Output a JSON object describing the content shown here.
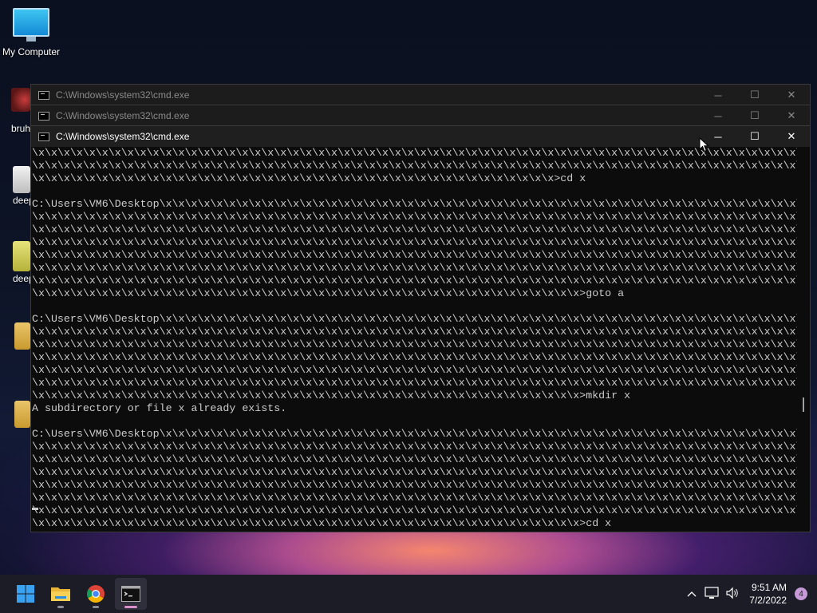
{
  "desktop": {
    "icons": [
      {
        "label": "My Computer"
      },
      {
        "label": "bruh"
      },
      {
        "label": "deep"
      },
      {
        "label": "deep"
      }
    ]
  },
  "windows": [
    {
      "title": "C:\\Windows\\system32\\cmd.exe",
      "state": "inactive"
    },
    {
      "title": "C:\\Windows\\system32\\cmd.exe",
      "state": "inactive"
    },
    {
      "title": "C:\\Windows\\system32\\cmd.exe",
      "state": "active"
    }
  ],
  "window_controls": {
    "minimize": "─",
    "maximize": "☐",
    "close": "✕"
  },
  "console": {
    "lines": [
      "\\x\\x\\x\\x\\x\\x\\x\\x\\x\\x\\x\\x\\x\\x\\x\\x\\x\\x\\x\\x\\x\\x\\x\\x\\x\\x\\x\\x\\x\\x\\x\\x\\x\\x\\x\\x\\x\\x\\x\\x\\x\\x\\x\\x\\x\\x\\x\\x\\x\\x\\x\\x\\x\\x\\x\\x\\x\\x\\x\\x\\x\\x\\x",
      "\\x\\x\\x\\x\\x\\x\\x\\x\\x\\x\\x\\x\\x\\x\\x\\x\\x\\x\\x\\x\\x\\x\\x\\x\\x\\x\\x\\x\\x\\x\\x\\x\\x\\x\\x\\x\\x\\x\\x\\x\\x\\x\\x\\x\\x\\x\\x\\x\\x\\x\\x\\x\\x\\x\\x\\x\\x\\x\\x\\x\\x\\x\\x",
      "\\x\\x\\x\\x\\x\\x\\x\\x\\x\\x\\x\\x\\x\\x\\x\\x\\x\\x\\x\\x\\x\\x\\x\\x\\x\\x\\x\\x\\x\\x\\x\\x\\x\\x\\x\\x\\x\\x\\x\\x\\x>cd x",
      "",
      "C:\\Users\\VM6\\Desktop\\x\\x\\x\\x\\x\\x\\x\\x\\x\\x\\x\\x\\x\\x\\x\\x\\x\\x\\x\\x\\x\\x\\x\\x\\x\\x\\x\\x\\x\\x\\x\\x\\x\\x\\x\\x\\x\\x\\x\\x\\x\\x\\x\\x\\x\\x\\x\\x\\x\\x\\x\\x\\x",
      "\\x\\x\\x\\x\\x\\x\\x\\x\\x\\x\\x\\x\\x\\x\\x\\x\\x\\x\\x\\x\\x\\x\\x\\x\\x\\x\\x\\x\\x\\x\\x\\x\\x\\x\\x\\x\\x\\x\\x\\x\\x\\x\\x\\x\\x\\x\\x\\x\\x\\x\\x\\x\\x\\x\\x\\x\\x\\x\\x\\x\\x\\x\\x",
      "\\x\\x\\x\\x\\x\\x\\x\\x\\x\\x\\x\\x\\x\\x\\x\\x\\x\\x\\x\\x\\x\\x\\x\\x\\x\\x\\x\\x\\x\\x\\x\\x\\x\\x\\x\\x\\x\\x\\x\\x\\x\\x\\x\\x\\x\\x\\x\\x\\x\\x\\x\\x\\x\\x\\x\\x\\x\\x\\x\\x\\x\\x\\x",
      "\\x\\x\\x\\x\\x\\x\\x\\x\\x\\x\\x\\x\\x\\x\\x\\x\\x\\x\\x\\x\\x\\x\\x\\x\\x\\x\\x\\x\\x\\x\\x\\x\\x\\x\\x\\x\\x\\x\\x\\x\\x\\x\\x\\x\\x\\x\\x\\x\\x\\x\\x\\x\\x\\x\\x\\x\\x\\x\\x\\x\\x\\x\\x",
      "\\x\\x\\x\\x\\x\\x\\x\\x\\x\\x\\x\\x\\x\\x\\x\\x\\x\\x\\x\\x\\x\\x\\x\\x\\x\\x\\x\\x\\x\\x\\x\\x\\x\\x\\x\\x\\x\\x\\x\\x\\x\\x\\x\\x\\x\\x\\x\\x\\x\\x\\x\\x\\x\\x\\x\\x\\x\\x\\x\\x\\x\\x\\x",
      "\\x\\x\\x\\x\\x\\x\\x\\x\\x\\x\\x\\x\\x\\x\\x\\x\\x\\x\\x\\x\\x\\x\\x\\x\\x\\x\\x\\x\\x\\x\\x\\x\\x\\x\\x\\x\\x\\x\\x\\x\\x\\x\\x\\x\\x\\x\\x\\x\\x\\x\\x\\x\\x\\x\\x\\x\\x\\x\\x\\x\\x\\x\\x",
      "\\x\\x\\x\\x\\x\\x\\x\\x\\x\\x\\x\\x\\x\\x\\x\\x\\x\\x\\x\\x\\x\\x\\x\\x\\x\\x\\x\\x\\x\\x\\x\\x\\x\\x\\x\\x\\x\\x\\x\\x\\x\\x\\x\\x\\x\\x\\x\\x\\x\\x\\x\\x\\x\\x\\x\\x\\x\\x\\x\\x\\x\\x\\x",
      "\\x\\x\\x\\x\\x\\x\\x\\x\\x\\x\\x\\x\\x\\x\\x\\x\\x\\x\\x\\x\\x\\x\\x\\x\\x\\x\\x\\x\\x\\x\\x\\x\\x\\x\\x\\x\\x\\x\\x\\x\\x\\x\\x>goto a",
      "",
      "C:\\Users\\VM6\\Desktop\\x\\x\\x\\x\\x\\x\\x\\x\\x\\x\\x\\x\\x\\x\\x\\x\\x\\x\\x\\x\\x\\x\\x\\x\\x\\x\\x\\x\\x\\x\\x\\x\\x\\x\\x\\x\\x\\x\\x\\x\\x\\x\\x\\x\\x\\x\\x\\x\\x\\x\\x\\x\\x",
      "\\x\\x\\x\\x\\x\\x\\x\\x\\x\\x\\x\\x\\x\\x\\x\\x\\x\\x\\x\\x\\x\\x\\x\\x\\x\\x\\x\\x\\x\\x\\x\\x\\x\\x\\x\\x\\x\\x\\x\\x\\x\\x\\x\\x\\x\\x\\x\\x\\x\\x\\x\\x\\x\\x\\x\\x\\x\\x\\x\\x\\x\\x\\x",
      "\\x\\x\\x\\x\\x\\x\\x\\x\\x\\x\\x\\x\\x\\x\\x\\x\\x\\x\\x\\x\\x\\x\\x\\x\\x\\x\\x\\x\\x\\x\\x\\x\\x\\x\\x\\x\\x\\x\\x\\x\\x\\x\\x\\x\\x\\x\\x\\x\\x\\x\\x\\x\\x\\x\\x\\x\\x\\x\\x\\x\\x\\x\\x",
      "\\x\\x\\x\\x\\x\\x\\x\\x\\x\\x\\x\\x\\x\\x\\x\\x\\x\\x\\x\\x\\x\\x\\x\\x\\x\\x\\x\\x\\x\\x\\x\\x\\x\\x\\x\\x\\x\\x\\x\\x\\x\\x\\x\\x\\x\\x\\x\\x\\x\\x\\x\\x\\x\\x\\x\\x\\x\\x\\x\\x\\x\\x\\x",
      "\\x\\x\\x\\x\\x\\x\\x\\x\\x\\x\\x\\x\\x\\x\\x\\x\\x\\x\\x\\x\\x\\x\\x\\x\\x\\x\\x\\x\\x\\x\\x\\x\\x\\x\\x\\x\\x\\x\\x\\x\\x\\x\\x\\x\\x\\x\\x\\x\\x\\x\\x\\x\\x\\x\\x\\x\\x\\x\\x\\x\\x\\x\\x",
      "\\x\\x\\x\\x\\x\\x\\x\\x\\x\\x\\x\\x\\x\\x\\x\\x\\x\\x\\x\\x\\x\\x\\x\\x\\x\\x\\x\\x\\x\\x\\x\\x\\x\\x\\x\\x\\x\\x\\x\\x\\x\\x\\x\\x\\x\\x\\x\\x\\x\\x\\x\\x\\x\\x\\x\\x\\x\\x\\x\\x\\x\\x\\x",
      "\\x\\x\\x\\x\\x\\x\\x\\x\\x\\x\\x\\x\\x\\x\\x\\x\\x\\x\\x\\x\\x\\x\\x\\x\\x\\x\\x\\x\\x\\x\\x\\x\\x\\x\\x\\x\\x\\x\\x\\x\\x\\x\\x>mkdir x",
      "A subdirectory or file x already exists.",
      "",
      "C:\\Users\\VM6\\Desktop\\x\\x\\x\\x\\x\\x\\x\\x\\x\\x\\x\\x\\x\\x\\x\\x\\x\\x\\x\\x\\x\\x\\x\\x\\x\\x\\x\\x\\x\\x\\x\\x\\x\\x\\x\\x\\x\\x\\x\\x\\x\\x\\x\\x\\x\\x\\x\\x\\x\\x\\x\\x\\x",
      "\\x\\x\\x\\x\\x\\x\\x\\x\\x\\x\\x\\x\\x\\x\\x\\x\\x\\x\\x\\x\\x\\x\\x\\x\\x\\x\\x\\x\\x\\x\\x\\x\\x\\x\\x\\x\\x\\x\\x\\x\\x\\x\\x\\x\\x\\x\\x\\x\\x\\x\\x\\x\\x\\x\\x\\x\\x\\x\\x\\x\\x\\x\\x",
      "\\x\\x\\x\\x\\x\\x\\x\\x\\x\\x\\x\\x\\x\\x\\x\\x\\x\\x\\x\\x\\x\\x\\x\\x\\x\\x\\x\\x\\x\\x\\x\\x\\x\\x\\x\\x\\x\\x\\x\\x\\x\\x\\x\\x\\x\\x\\x\\x\\x\\x\\x\\x\\x\\x\\x\\x\\x\\x\\x\\x\\x\\x\\x",
      "\\x\\x\\x\\x\\x\\x\\x\\x\\x\\x\\x\\x\\x\\x\\x\\x\\x\\x\\x\\x\\x\\x\\x\\x\\x\\x\\x\\x\\x\\x\\x\\x\\x\\x\\x\\x\\x\\x\\x\\x\\x\\x\\x\\x\\x\\x\\x\\x\\x\\x\\x\\x\\x\\x\\x\\x\\x\\x\\x\\x\\x\\x\\x",
      "\\x\\x\\x\\x\\x\\x\\x\\x\\x\\x\\x\\x\\x\\x\\x\\x\\x\\x\\x\\x\\x\\x\\x\\x\\x\\x\\x\\x\\x\\x\\x\\x\\x\\x\\x\\x\\x\\x\\x\\x\\x\\x\\x\\x\\x\\x\\x\\x\\x\\x\\x\\x\\x\\x\\x\\x\\x\\x\\x\\x\\x\\x\\x",
      "\\x\\x\\x\\x\\x\\x\\x\\x\\x\\x\\x\\x\\x\\x\\x\\x\\x\\x\\x\\x\\x\\x\\x\\x\\x\\x\\x\\x\\x\\x\\x\\x\\x\\x\\x\\x\\x\\x\\x\\x\\x\\x\\x\\x\\x\\x\\x\\x\\x\\x\\x\\x\\x\\x\\x\\x\\x\\x\\x\\x\\x\\x\\x",
      "\\x\\x\\x\\x\\x\\x\\x\\x\\x\\x\\x\\x\\x\\x\\x\\x\\x\\x\\x\\x\\x\\x\\x\\x\\x\\x\\x\\x\\x\\x\\x\\x\\x\\x\\x\\x\\x\\x\\x\\x\\x\\x\\x\\x\\x\\x\\x\\x\\x\\x\\x\\x\\x\\x\\x\\x\\x\\x\\x\\x\\x\\x\\x",
      "\\x\\x\\x\\x\\x\\x\\x\\x\\x\\x\\x\\x\\x\\x\\x\\x\\x\\x\\x\\x\\x\\x\\x\\x\\x\\x\\x\\x\\x\\x\\x\\x\\x\\x\\x\\x\\x\\x\\x\\x\\x\\x\\x>cd x"
    ]
  },
  "taskbar": {
    "apps": [
      {
        "icon": "windows-start-icon"
      },
      {
        "icon": "file-explorer-icon"
      },
      {
        "icon": "chrome-icon"
      },
      {
        "icon": "terminal-icon"
      }
    ],
    "clock": {
      "time": "9:51 AM",
      "date": "7/2/2022"
    },
    "notifications": "4"
  },
  "colors": {
    "console_bg": "#0c0c0c",
    "console_fg": "#cccccc",
    "taskbar_bg": "#1b1c26",
    "accent": "#d98fc9"
  }
}
